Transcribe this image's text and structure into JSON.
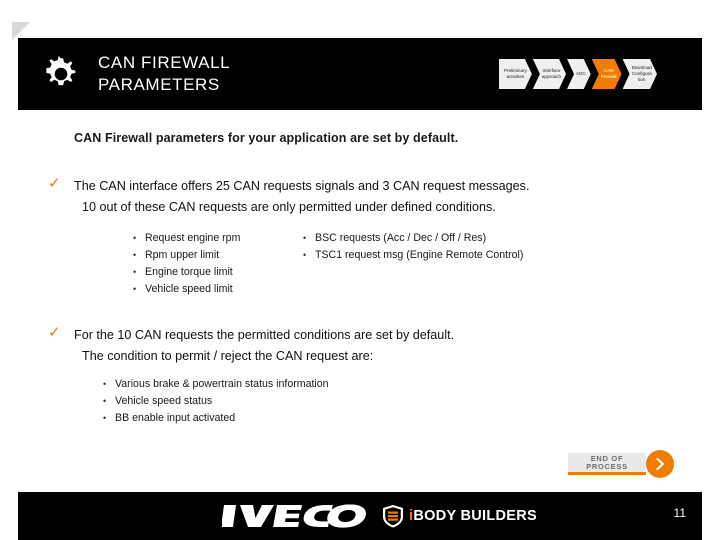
{
  "header": {
    "title_line1": "CAN FIREWALL",
    "title_line2": "PARAMETERS",
    "gear_icon": "gear-icon"
  },
  "process_steps": [
    {
      "line1": "Preliminary",
      "line2": "activities",
      "line3": "",
      "active": false
    },
    {
      "line1": "Interface",
      "line2": "approach",
      "line3": "",
      "active": false
    },
    {
      "line1": "ADC",
      "line2": "",
      "line3": "",
      "active": false
    },
    {
      "line1": "CAN",
      "line2": "Firewall",
      "line3": "",
      "active": true
    },
    {
      "line1": "Download",
      "line2": "Configura",
      "line3": "tion",
      "active": false
    }
  ],
  "content": {
    "intro": "CAN Firewall parameters for your application are set by default.",
    "block1": {
      "check": "✓",
      "line1": "The CAN interface offers 25 CAN requests signals and 3 CAN request messages.",
      "line2": "10 out of these CAN requests are only permitted under defined conditions.",
      "list_left": [
        "Request engine rpm",
        "Rpm upper limit",
        "Engine torque limit",
        "Vehicle speed limit"
      ],
      "list_right": [
        "BSC requests (Acc / Dec / Off / Res)",
        "TSC1 request msg (Engine Remote Control)"
      ]
    },
    "block2": {
      "check": "✓",
      "line1": "For the 10 CAN requests the permitted conditions are set by default.",
      "line2": "The condition to permit / reject the CAN request are:",
      "list": [
        "Various brake & powertrain status information",
        "Vehicle speed status",
        "BB enable input activated"
      ]
    }
  },
  "end_of_process": {
    "label": "END OF\nPROCESS",
    "label_line1": "END OF",
    "label_line2": "PROCESS",
    "arrow_icon": "chevron-right-icon"
  },
  "footer": {
    "iveco_logo": "iveco-logo",
    "bodybuilders_prefix": "i",
    "bodybuilders_label": "BODY BUILDERS",
    "page_number": "11"
  },
  "colors": {
    "accent": "#f07d00",
    "header_bg": "#000000",
    "text": "#111111"
  }
}
